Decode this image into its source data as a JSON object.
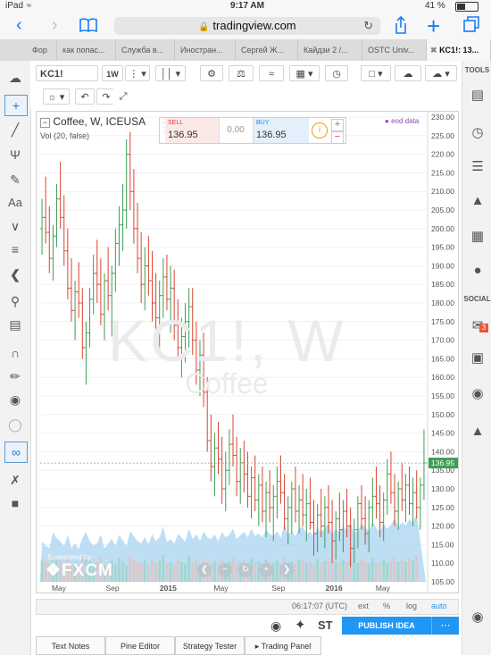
{
  "status_bar": {
    "device": "iPad",
    "time": "9:17 AM",
    "battery": "41 %"
  },
  "browser": {
    "url": "tradingview.com"
  },
  "tabs": [
    {
      "label": "Фор"
    },
    {
      "label": "как попас..."
    },
    {
      "label": "Служба в..."
    },
    {
      "label": "Иностран..."
    },
    {
      "label": "Сергей Ж..."
    },
    {
      "label": "Кайдзи 2 /..."
    },
    {
      "label": "OSTC Univ..."
    },
    {
      "label": "KC1!: 13..."
    }
  ],
  "toolbar": {
    "symbol": "KC1!",
    "interval": "1W"
  },
  "legend": {
    "title": "Coffee, W, ICEUSA",
    "volume": "Vol (20, false)",
    "eod": "eod data"
  },
  "trade": {
    "sell_label": "SELL",
    "sell_price": "136.95",
    "spread": "0.00",
    "buy_label": "BUY",
    "buy_price": "136.95"
  },
  "watermark": {
    "symbol": "KC1!, W",
    "name": "Coffee"
  },
  "sponsor": {
    "text": "Sponsored by",
    "brand": "FXCM"
  },
  "price_axis": [
    "230.00",
    "225.00",
    "220.00",
    "215.00",
    "210.00",
    "205.00",
    "200.00",
    "195.00",
    "190.00",
    "185.00",
    "180.00",
    "175.00",
    "170.00",
    "165.00",
    "160.00",
    "155.00",
    "150.00",
    "145.00",
    "140.00",
    "135.00",
    "130.00",
    "125.00",
    "120.00",
    "115.00",
    "110.00",
    "105.00"
  ],
  "last_price": "136.95",
  "time_axis": [
    "May",
    "Sep",
    "2015",
    "May",
    "Sep",
    "2016",
    "May"
  ],
  "bottom_info": {
    "clock": "06:17:07 (UTC)",
    "ext": "ext",
    "pct": "%",
    "log": "log",
    "auto": "auto"
  },
  "publish": "PUBLISH IDEA",
  "right_sections": {
    "tools": "TOOLS",
    "social": "SOCIAL",
    "badge": "3"
  },
  "bottom_tabs": [
    "Text Notes",
    "Pine Editor",
    "Strategy Tester",
    "Trading Panel"
  ],
  "chart_data": {
    "type": "ohlc",
    "title": "Coffee, W, ICEUSA",
    "ylim": [
      105,
      230
    ],
    "x_ticks": [
      "May",
      "Sep",
      "2015",
      "May",
      "Sep",
      "2016",
      "May"
    ],
    "bars": [
      [
        200,
        208,
        193,
        203
      ],
      [
        203,
        214,
        196,
        199
      ],
      [
        199,
        206,
        188,
        192
      ],
      [
        192,
        201,
        186,
        198
      ],
      [
        198,
        212,
        195,
        208
      ],
      [
        208,
        218,
        200,
        203
      ],
      [
        203,
        209,
        190,
        194
      ],
      [
        194,
        200,
        181,
        184
      ],
      [
        184,
        192,
        175,
        178
      ],
      [
        178,
        186,
        170,
        183
      ],
      [
        183,
        191,
        176,
        180
      ],
      [
        180,
        184,
        165,
        168
      ],
      [
        168,
        175,
        158,
        172
      ],
      [
        172,
        184,
        168,
        181
      ],
      [
        181,
        193,
        177,
        188
      ],
      [
        188,
        197,
        180,
        185
      ],
      [
        185,
        192,
        174,
        177
      ],
      [
        177,
        188,
        170,
        186
      ],
      [
        186,
        195,
        178,
        182
      ],
      [
        182,
        190,
        171,
        188
      ],
      [
        188,
        200,
        183,
        196
      ],
      [
        196,
        206,
        190,
        201
      ],
      [
        201,
        212,
        194,
        205
      ],
      [
        205,
        224,
        200,
        220
      ],
      [
        220,
        226,
        205,
        210
      ],
      [
        210,
        216,
        196,
        200
      ],
      [
        200,
        207,
        188,
        192
      ],
      [
        192,
        199,
        180,
        185
      ],
      [
        185,
        195,
        178,
        190
      ],
      [
        190,
        198,
        182,
        186
      ],
      [
        186,
        194,
        175,
        180
      ],
      [
        180,
        188,
        172,
        176
      ],
      [
        176,
        186,
        168,
        182
      ],
      [
        182,
        192,
        176,
        187
      ],
      [
        187,
        193,
        178,
        181
      ],
      [
        181,
        190,
        172,
        184
      ],
      [
        184,
        189,
        170,
        174
      ],
      [
        174,
        181,
        165,
        168
      ],
      [
        168,
        176,
        160,
        171
      ],
      [
        171,
        180,
        164,
        175
      ],
      [
        175,
        184,
        168,
        179
      ],
      [
        179,
        184,
        166,
        170
      ],
      [
        170,
        175,
        158,
        162
      ],
      [
        162,
        170,
        155,
        166
      ],
      [
        166,
        172,
        152,
        156
      ],
      [
        156,
        160,
        140,
        143
      ],
      [
        143,
        150,
        132,
        136
      ],
      [
        136,
        145,
        128,
        141
      ],
      [
        141,
        148,
        134,
        138
      ],
      [
        138,
        144,
        126,
        130
      ],
      [
        130,
        140,
        124,
        135
      ],
      [
        135,
        146,
        131,
        142
      ],
      [
        142,
        150,
        136,
        139
      ],
      [
        139,
        144,
        128,
        132
      ],
      [
        132,
        141,
        126,
        137
      ],
      [
        137,
        143,
        129,
        134
      ],
      [
        134,
        140,
        125,
        128
      ],
      [
        128,
        136,
        122,
        133
      ],
      [
        133,
        139,
        124,
        127
      ],
      [
        127,
        134,
        120,
        131
      ],
      [
        131,
        136,
        121,
        124
      ],
      [
        124,
        132,
        117,
        129
      ],
      [
        129,
        135,
        121,
        125
      ],
      [
        125,
        131,
        116,
        128
      ],
      [
        128,
        136,
        122,
        132
      ],
      [
        132,
        139,
        126,
        129
      ],
      [
        129,
        134,
        119,
        122
      ],
      [
        122,
        128,
        115,
        125
      ],
      [
        125,
        132,
        118,
        130
      ],
      [
        130,
        136,
        121,
        124
      ],
      [
        124,
        131,
        118,
        127
      ],
      [
        127,
        134,
        120,
        123
      ],
      [
        123,
        130,
        116,
        126
      ],
      [
        126,
        133,
        119,
        121
      ],
      [
        121,
        127,
        112,
        118
      ],
      [
        118,
        126,
        113,
        123
      ],
      [
        123,
        130,
        117,
        120
      ],
      [
        120,
        128,
        114,
        125
      ],
      [
        125,
        131,
        118,
        121
      ],
      [
        121,
        127,
        110,
        116
      ],
      [
        116,
        124,
        111,
        122
      ],
      [
        122,
        129,
        116,
        119
      ],
      [
        119,
        127,
        113,
        124
      ],
      [
        124,
        130,
        117,
        120
      ],
      [
        120,
        125,
        109,
        114
      ],
      [
        114,
        122,
        110,
        119
      ],
      [
        119,
        128,
        114,
        126
      ],
      [
        126,
        131,
        119,
        122
      ],
      [
        122,
        128,
        115,
        118
      ],
      [
        118,
        127,
        113,
        125
      ],
      [
        125,
        133,
        120,
        128
      ],
      [
        128,
        136,
        122,
        126
      ],
      [
        126,
        131,
        117,
        121
      ],
      [
        121,
        129,
        116,
        127
      ],
      [
        127,
        138,
        123,
        134
      ],
      [
        134,
        140,
        126,
        129
      ],
      [
        129,
        134,
        120,
        124
      ],
      [
        124,
        132,
        119,
        130
      ],
      [
        130,
        137,
        124,
        127
      ],
      [
        127,
        134,
        121,
        131
      ],
      [
        131,
        136,
        123,
        126
      ],
      [
        126,
        133,
        120,
        129
      ],
      [
        129,
        135,
        122,
        125
      ],
      [
        125,
        133,
        119,
        131
      ],
      [
        131,
        146,
        127,
        137
      ]
    ],
    "volume": [
      34,
      30,
      28,
      41,
      36,
      33,
      29,
      38,
      27,
      31,
      26,
      35,
      40,
      32,
      28,
      30,
      37,
      25,
      29,
      33,
      27,
      36,
      31,
      26,
      39,
      34,
      30,
      28,
      33,
      27,
      35,
      29,
      32,
      41,
      28,
      30,
      26,
      34,
      31,
      27,
      38,
      29,
      33,
      27,
      35,
      30,
      28,
      32,
      26,
      34,
      29,
      31,
      36,
      27,
      30,
      33,
      28,
      35,
      29,
      31,
      27,
      34,
      30,
      28,
      32,
      26,
      37,
      29,
      31,
      27,
      33,
      35,
      28,
      30,
      26,
      34,
      29,
      32,
      36,
      27,
      31,
      28,
      33,
      30,
      35,
      27,
      29,
      34,
      31,
      28,
      36,
      30,
      27,
      33,
      29,
      32,
      38,
      30,
      34,
      31,
      36,
      33,
      40
    ]
  }
}
